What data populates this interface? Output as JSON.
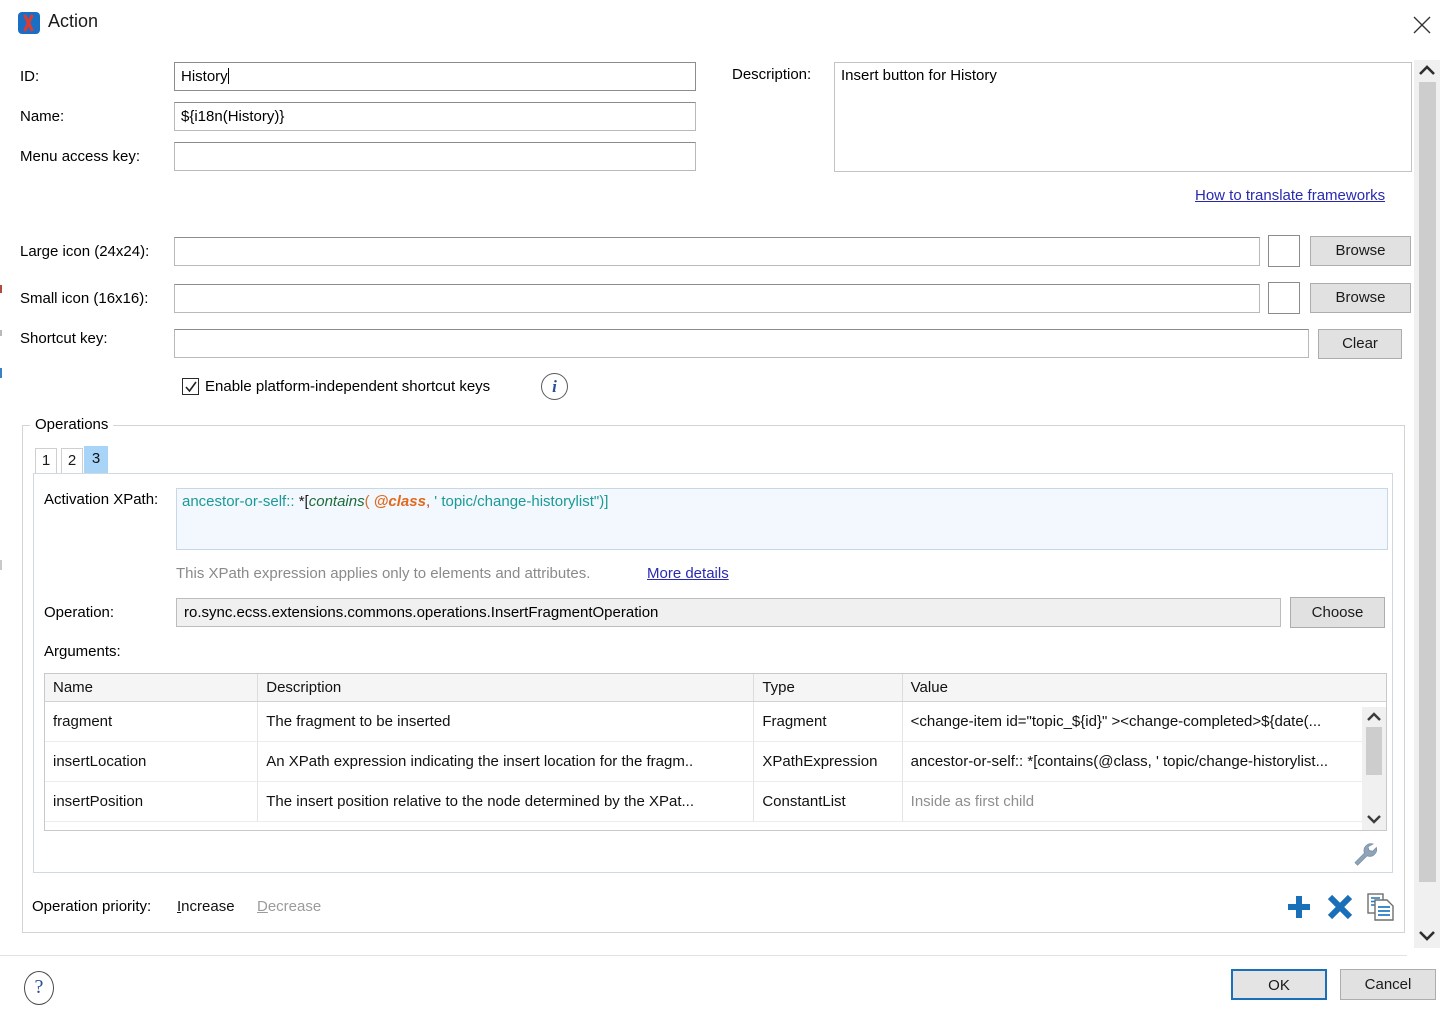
{
  "window": {
    "title": "Action",
    "app_icon": "oxygen-x-icon",
    "close_label": "×"
  },
  "form": {
    "id": {
      "label": "ID:",
      "value": "History"
    },
    "name": {
      "label": "Name:",
      "value": "${i18n(History)}"
    },
    "menu_access_key": {
      "label": "Menu access key:",
      "value": ""
    },
    "description": {
      "label": "Description:",
      "value": "Insert button for History"
    },
    "translate_link": "How to translate frameworks",
    "large_icon": {
      "label": "Large icon (24x24):",
      "value": "",
      "browse_label": "Browse"
    },
    "small_icon": {
      "label": "Small icon (16x16):",
      "value": "",
      "browse_label": "Browse"
    },
    "shortcut_key": {
      "label": "Shortcut key:",
      "value": "",
      "clear_label": "Clear"
    },
    "platform_independent": {
      "label": "Enable platform-independent shortcut keys",
      "checked": true,
      "info_glyph": "i"
    }
  },
  "operations": {
    "group_title": "Operations",
    "tabs": [
      {
        "label": "1",
        "selected": false
      },
      {
        "label": "2",
        "selected": false
      },
      {
        "label": "3",
        "selected": true
      }
    ],
    "activation_xpath": {
      "label": "Activation XPath:",
      "tokens": [
        {
          "text": "ancestor-or-self::",
          "kind": "axis"
        },
        {
          "text": " *[",
          "kind": "plain"
        },
        {
          "text": "contains",
          "kind": "fn"
        },
        {
          "text": "(",
          "kind": "paren"
        },
        {
          "text": " @class",
          "kind": "attr"
        },
        {
          "text": ",",
          "kind": "comma"
        },
        {
          "text": " ' topic/change-historylist\")]",
          "kind": "str"
        }
      ],
      "plain_value": "ancestor-or-self:: *[contains( @class, ' topic/change-historylist\")]"
    },
    "hint_text": "This XPath expression applies only to elements and attributes.",
    "hint_link": "More details",
    "operation": {
      "label": "Operation:",
      "value": "ro.sync.ecss.extensions.commons.operations.InsertFragmentOperation",
      "choose_label": "Choose"
    },
    "arguments": {
      "label": "Arguments:",
      "columns": [
        "Name",
        "Description",
        "Type",
        "Value"
      ],
      "rows": [
        {
          "name": "fragment",
          "description": "The fragment to be inserted",
          "type": "Fragment",
          "value": "<change-item id=\"topic_${id}\" ><change-completed>${date(...",
          "value_muted": false
        },
        {
          "name": "insertLocation",
          "description": "An XPath expression indicating the insert location for the fragm..",
          "type": "XPathExpression",
          "value": "ancestor-or-self:: *[contains(@class, ' topic/change-historylist...",
          "value_muted": false
        },
        {
          "name": "insertPosition",
          "description": "The insert position relative to the node determined by the XPat...",
          "type": "ConstantList",
          "value": "Inside as first child",
          "value_muted": true
        }
      ]
    },
    "priority": {
      "label": "Operation priority:",
      "increase": {
        "label": "Increase",
        "mnemonic": "I",
        "enabled": true
      },
      "decrease": {
        "label": "Decrease",
        "mnemonic": "D",
        "enabled": false
      }
    },
    "toolbar_icons": [
      {
        "name": "add-operation-icon",
        "glyph": "plus"
      },
      {
        "name": "remove-operation-icon",
        "glyph": "cross"
      },
      {
        "name": "duplicate-operation-icon",
        "glyph": "copy"
      }
    ],
    "settings_icon": "wrench-icon"
  },
  "footer": {
    "help_glyph": "?",
    "ok_label": "OK",
    "cancel_label": "Cancel"
  },
  "colors": {
    "accent_blue": "#1a6fc4",
    "tab_selected": "#a8d4f7",
    "link": "#2a2ab0",
    "muted": "#8a8a8a",
    "xpath_bg": "#f2f8fe"
  }
}
